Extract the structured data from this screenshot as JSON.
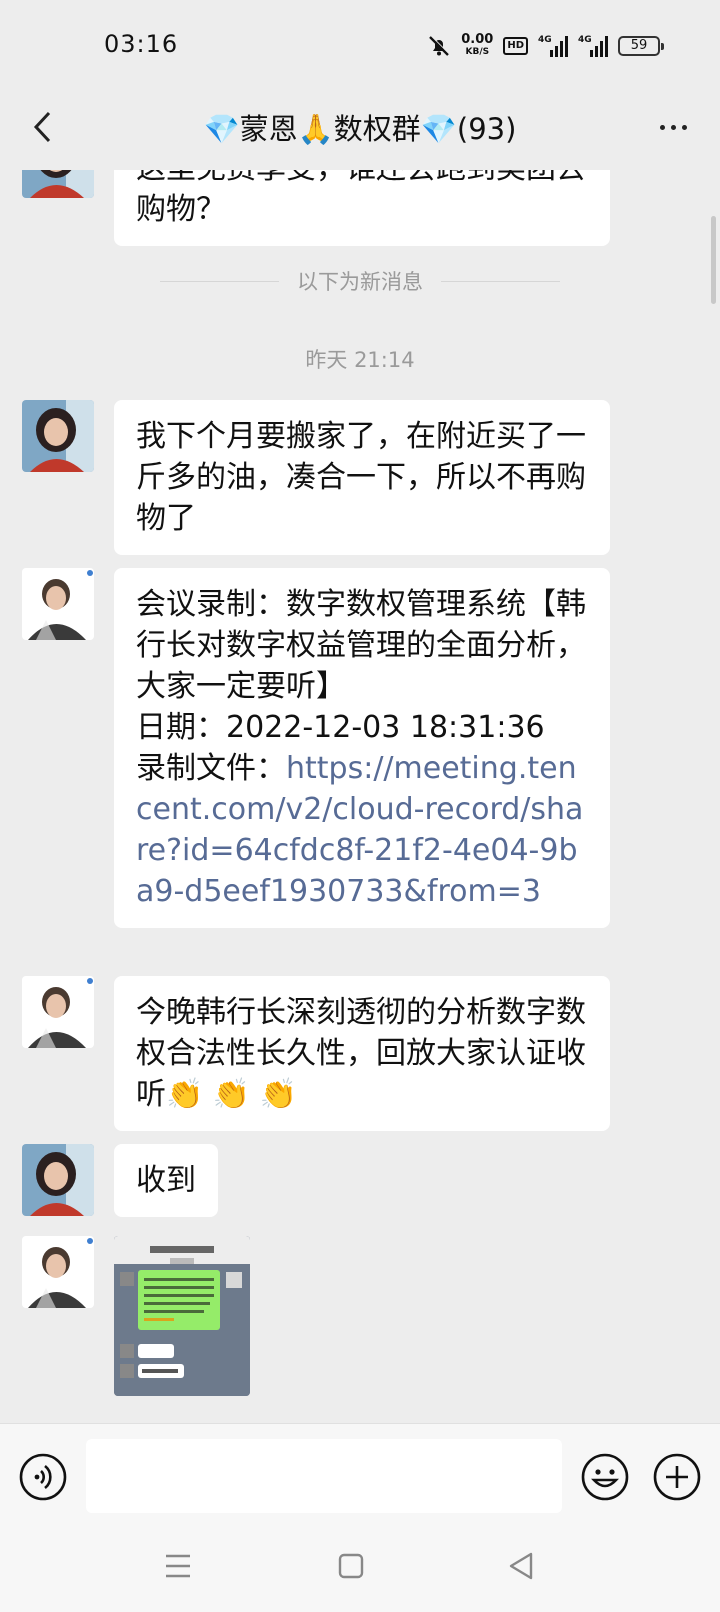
{
  "status_bar": {
    "time": "03:16",
    "net_speed_value": "0.00",
    "net_speed_unit": "KB/S",
    "hd_badge": "HD",
    "signal1_gen": "4G",
    "signal2_gen": "4G",
    "battery": "59"
  },
  "header": {
    "title": "💎蒙恩🙏数权群💎(93)"
  },
  "messages": {
    "m0_text": "这里免费享受，谁还会跑到美团去购物？",
    "new_divider": "以下为新消息",
    "timestamp": "昨天 21:14",
    "m1_text": "我下个月要搬家了，在附近买了一斤多的油，凑合一下，所以不再购物了",
    "m2_line1": "会议录制：数字数权管理系统【韩行长对数字权益管理的全面分析，大家一定要听】",
    "m2_line2": "日期：2022-12-03 18:31:36",
    "m2_label": "录制文件：",
    "m2_link": "https://meeting.tencent.com/v2/cloud-record/share?id=64cfdc8f-21f2-4e04-9ba9-d5eef1930733&from=3",
    "m3_text": "今晚韩行长深刻透彻的分析数字数权合法性长久性，回放大家认证收听👏 👏 👏",
    "m4_text": "收到"
  },
  "colors": {
    "link": "#576b95",
    "bubble": "#ffffff",
    "background": "#ededed"
  },
  "icons": {
    "back": "chevron-left-icon",
    "more": "more-dots-icon",
    "voice": "voice-icon",
    "emoji": "emoji-icon",
    "plus": "plus-icon"
  }
}
